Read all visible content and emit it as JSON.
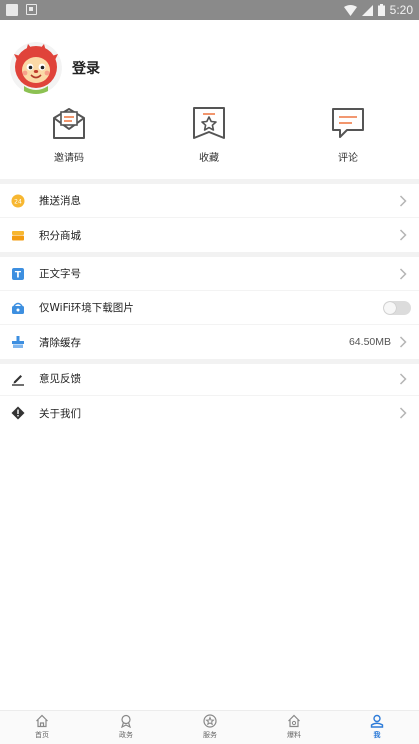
{
  "status_bar": {
    "time": "5:20"
  },
  "profile": {
    "login_label": "登录"
  },
  "quick_actions": [
    {
      "label": "邀请码",
      "icon": "invite-envelope-icon"
    },
    {
      "label": "收藏",
      "icon": "favorite-star-icon"
    },
    {
      "label": "评论",
      "icon": "comment-bubble-icon"
    }
  ],
  "menu_groups": [
    {
      "items": [
        {
          "label": "推送消息",
          "icon": "push-message-icon"
        },
        {
          "label": "积分商城",
          "icon": "points-mall-icon"
        }
      ]
    },
    {
      "items": [
        {
          "label": "正文字号",
          "icon": "font-size-icon"
        },
        {
          "label": "仅WiFi环境下载图片",
          "icon": "wifi-image-icon",
          "toggle_on": false
        },
        {
          "label": "清除缓存",
          "icon": "clear-cache-icon",
          "value": "64.50MB"
        }
      ]
    },
    {
      "items": [
        {
          "label": "意见反馈",
          "icon": "feedback-pen-icon"
        },
        {
          "label": "关于我们",
          "icon": "about-us-icon"
        }
      ]
    }
  ],
  "tab_bar": {
    "tabs": [
      {
        "label": "首页",
        "icon": "home-icon",
        "active": false
      },
      {
        "label": "政务",
        "icon": "government-icon",
        "active": false
      },
      {
        "label": "服务",
        "icon": "service-icon",
        "active": false
      },
      {
        "label": "爆料",
        "icon": "report-icon",
        "active": false
      },
      {
        "label": "我",
        "icon": "profile-icon",
        "active": true
      }
    ]
  },
  "colors": {
    "accent": "#2d7bd8",
    "icon_orange": "#f08a5d",
    "separator": "#f2f2f2"
  }
}
